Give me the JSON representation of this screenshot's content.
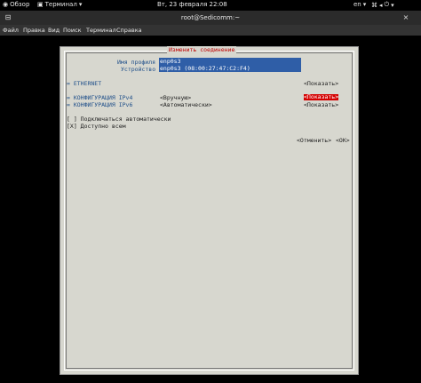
{
  "topbar": {
    "overview": "Обзор",
    "terminal": "Терминал",
    "clock": "Вт, 23 февраля 22:08",
    "lang": "en"
  },
  "window": {
    "title": "root@Sedicomm:~"
  },
  "menu": [
    "Файл",
    "Правка",
    "Вид",
    "Поиск",
    "Терминал",
    "Справка"
  ],
  "dialog": {
    "title": "Изменить соединение",
    "profile_label": "Имя профиля",
    "profile_value": "enp0s3",
    "device_label": "Устройство",
    "device_value": "enp0s3 (08:00:27:47:C2:F4)",
    "ethernet": "= ETHERNET",
    "ethernet_show": "<Показать>",
    "ipv4_label": "= КОНФИГУРАЦИЯ IPv4",
    "ipv4_value": "<Вручную>",
    "ipv4_show": "<Показать>",
    "ipv6_label": "= КОНФИГУРАЦИЯ IPv6",
    "ipv6_value": "<Автоматически>",
    "ipv6_show": "<Показать>",
    "auto_connect": "[ ] Подключаться автоматически",
    "all_users": "[X] Доступно всем",
    "cancel": "<Отменить>",
    "ok": "<OK>"
  }
}
